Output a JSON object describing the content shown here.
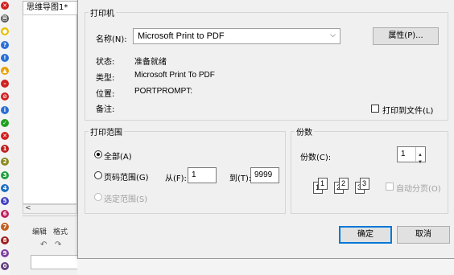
{
  "sidebar_icons": [
    {
      "name": "close-icon",
      "glyph": "✕",
      "color": "#d02020"
    },
    {
      "name": "document-icon",
      "glyph": "🗎",
      "color": "#555555"
    },
    {
      "name": "lightbulb-icon",
      "glyph": "●",
      "color": "#e8c000"
    },
    {
      "name": "question-icon",
      "glyph": "?",
      "color": "#2a6fd6"
    },
    {
      "name": "exclamation-icon",
      "glyph": "!",
      "color": "#2a6fd6"
    },
    {
      "name": "warning-icon",
      "glyph": "▲",
      "color": "#e8a000"
    },
    {
      "name": "stop-icon",
      "glyph": "–",
      "color": "#d02020"
    },
    {
      "name": "forbidden-icon",
      "glyph": "⊘",
      "color": "#d02020"
    },
    {
      "name": "info-icon",
      "glyph": "i",
      "color": "#2a6fd6"
    },
    {
      "name": "check-icon",
      "glyph": "✓",
      "color": "#20a020"
    },
    {
      "name": "cross-icon",
      "glyph": "✕",
      "color": "#d02020"
    },
    {
      "name": "number-1-icon",
      "glyph": "1",
      "color": "#c02020"
    },
    {
      "name": "number-2-icon",
      "glyph": "2",
      "color": "#8a8a20"
    },
    {
      "name": "number-3-icon",
      "glyph": "3",
      "color": "#20a040"
    },
    {
      "name": "number-4-icon",
      "glyph": "4",
      "color": "#2070c0"
    },
    {
      "name": "number-5-icon",
      "glyph": "5",
      "color": "#4040c0"
    },
    {
      "name": "number-6-icon",
      "glyph": "6",
      "color": "#c02060"
    },
    {
      "name": "number-7-icon",
      "glyph": "7",
      "color": "#c06020"
    },
    {
      "name": "number-8-icon",
      "glyph": "8",
      "color": "#a02020"
    },
    {
      "name": "number-9-icon",
      "glyph": "9",
      "color": "#8040a0"
    },
    {
      "name": "number-0-icon",
      "glyph": "0",
      "color": "#604080"
    }
  ],
  "background_app": {
    "tab_title": "思维导图1*",
    "tab_edit": "编辑",
    "tab_format": "格式",
    "undo_glyph": "↶",
    "redo_glyph": "↷",
    "scroll_left_glyph": "<"
  },
  "printer": {
    "legend": "打印机",
    "name_label": "名称(N):",
    "name_value": "Microsoft Print to PDF",
    "properties_button": "属性(P)...",
    "status_label": "状态:",
    "status_value": "准备就绪",
    "type_label": "类型:",
    "type_value": "Microsoft Print To PDF",
    "location_label": "位置:",
    "location_value": "PORTPROMPT:",
    "comment_label": "备注:",
    "print_to_file_label": "打印到文件(L)",
    "dropdown_arrow": "⌵"
  },
  "print_range": {
    "legend": "打印范围",
    "all_label": "全部(A)",
    "pages_label": "页码范围(G)",
    "from_label": "从(F):",
    "from_value": "1",
    "to_label": "到(T):",
    "to_value": "9999",
    "selection_label": "选定范围(S)"
  },
  "copies": {
    "legend": "份数",
    "count_label": "份数(C):",
    "count_value": "1",
    "collate_label": "自动分页(O)",
    "spin_up": "▲",
    "spin_down": "▼",
    "collate_pages": [
      "1",
      "1",
      "2",
      "2",
      "3",
      "3"
    ]
  },
  "buttons": {
    "ok": "确定",
    "cancel": "取消"
  }
}
